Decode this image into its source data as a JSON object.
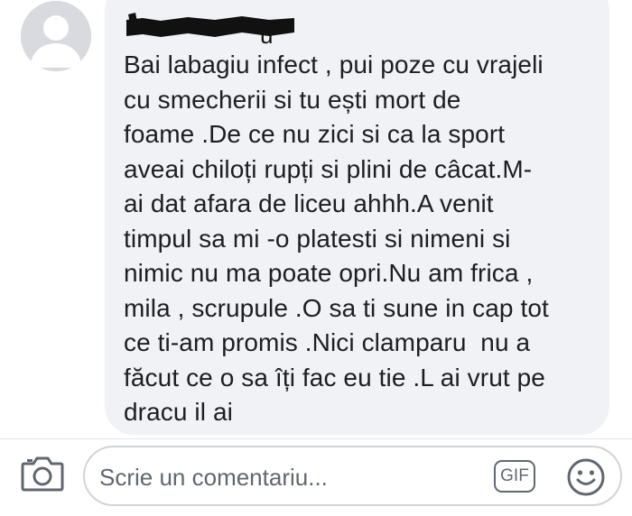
{
  "comment": {
    "author_visible_fragment": "u",
    "text": "Bai labagiu infect , pui poze cu vrajeli\ncu smecherii si tu ești mort de\nfoame .De ce nu zici si ca la sport\naveai chiloți rupți si plini de câcat.M-\nai dat afara de liceu ahhh.A venit\ntimpul sa mi -o platesti si nimeni si\nnimic nu ma poate opri.Nu am frica ,\nmila , scrupule .O sa ti sune in cap tot\nce ti-am promis .Nici clamparu  nu a\nfăcut ce o sa îți fac eu tie .L ai vrut pe\ndracu il ai",
    "avatar_icon": "default-profile-silhouette-icon"
  },
  "composer": {
    "placeholder": "Scrie un comentariu...",
    "camera_icon": "camera-icon",
    "gif_label": "GIF",
    "emoji_icon": "smiley-icon"
  },
  "colors": {
    "bubble_bg": "#f0f2f5",
    "text": "#1c1e21",
    "icon_gray": "#606770",
    "avatar_bg": "#d8dadf"
  }
}
